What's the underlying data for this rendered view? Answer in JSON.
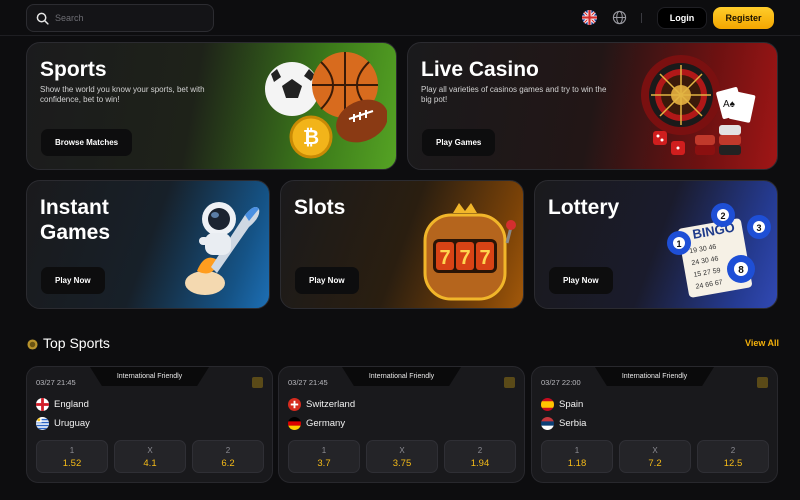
{
  "header": {
    "search_placeholder": "Search",
    "login_label": "Login",
    "register_label": "Register"
  },
  "cards": {
    "sports": {
      "title": "Sports",
      "description": "Show the world you know your sports, bet with confidence, bet to win!",
      "button": "Browse Matches"
    },
    "casino": {
      "title": "Live Casino",
      "description": "Play all varieties of casinos games and try to win the big pot!",
      "button": "Play Games"
    },
    "instant": {
      "title": "Instant Games",
      "button": "Play Now"
    },
    "slots": {
      "title": "Slots",
      "button": "Play Now"
    },
    "lottery": {
      "title": "Lottery",
      "button": "Play Now"
    }
  },
  "top_sports": {
    "title": "Top Sports",
    "view_all": "View All",
    "matches": [
      {
        "date": "03/27 21:45",
        "league": "International Friendly",
        "home": "England",
        "away": "Uruguay",
        "odds": [
          {
            "label": "1",
            "value": "1.52"
          },
          {
            "label": "X",
            "value": "4.1"
          },
          {
            "label": "2",
            "value": "6.2"
          }
        ]
      },
      {
        "date": "03/27 21:45",
        "league": "International Friendly",
        "home": "Switzerland",
        "away": "Germany",
        "odds": [
          {
            "label": "1",
            "value": "3.7"
          },
          {
            "label": "X",
            "value": "3.75"
          },
          {
            "label": "2",
            "value": "1.94"
          }
        ]
      },
      {
        "date": "03/27 22:00",
        "league": "International Friendly",
        "home": "Spain",
        "away": "Serbia",
        "odds": [
          {
            "label": "1",
            "value": "1.18"
          },
          {
            "label": "X",
            "value": "7.2"
          },
          {
            "label": "2",
            "value": "12.5"
          }
        ]
      }
    ]
  },
  "colors": {
    "accent": "#f3b00b",
    "register_bg": "#ffc21a",
    "odds_text": "#f5bb18"
  },
  "icons": [
    "search-icon",
    "uk-flag-icon",
    "globe-icon",
    "stats-icon",
    "trophy-icon"
  ]
}
